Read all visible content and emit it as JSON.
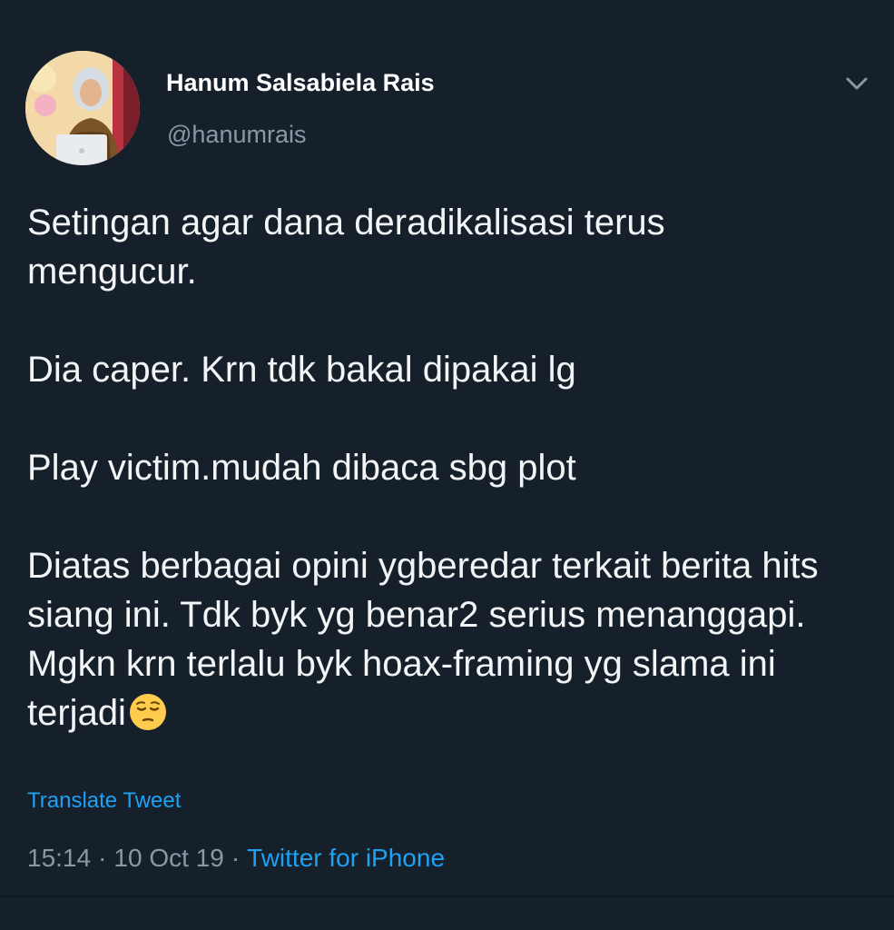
{
  "user": {
    "display_name": "Hanum Salsabiela Rais",
    "handle": "@hanumrais",
    "avatar_icon": "profile-photo"
  },
  "menu": {
    "icon": "chevron-down-icon"
  },
  "tweet": {
    "paragraphs": [
      "Setingan agar dana deradikalisasi terus mengucur.",
      "Dia caper. Krn tdk bakal dipakai lg",
      "Play victim.mudah dibaca sbg plot",
      "Diatas berbagai opini ygberedar terkait berita hits siang ini. Tdk byk yg benar2 serius menanggapi. Mgkn krn terlalu byk hoax-framing yg slama ini terjadi"
    ],
    "emoji": "pensive-face-emoji",
    "translate_label": "Translate Tweet"
  },
  "meta": {
    "time": "15:14",
    "separator": "·",
    "date": "10 Oct 19",
    "source": "Twitter for iPhone"
  },
  "colors": {
    "background": "#15202b",
    "accent": "#1da1f2",
    "secondary_text": "#8899a6"
  }
}
